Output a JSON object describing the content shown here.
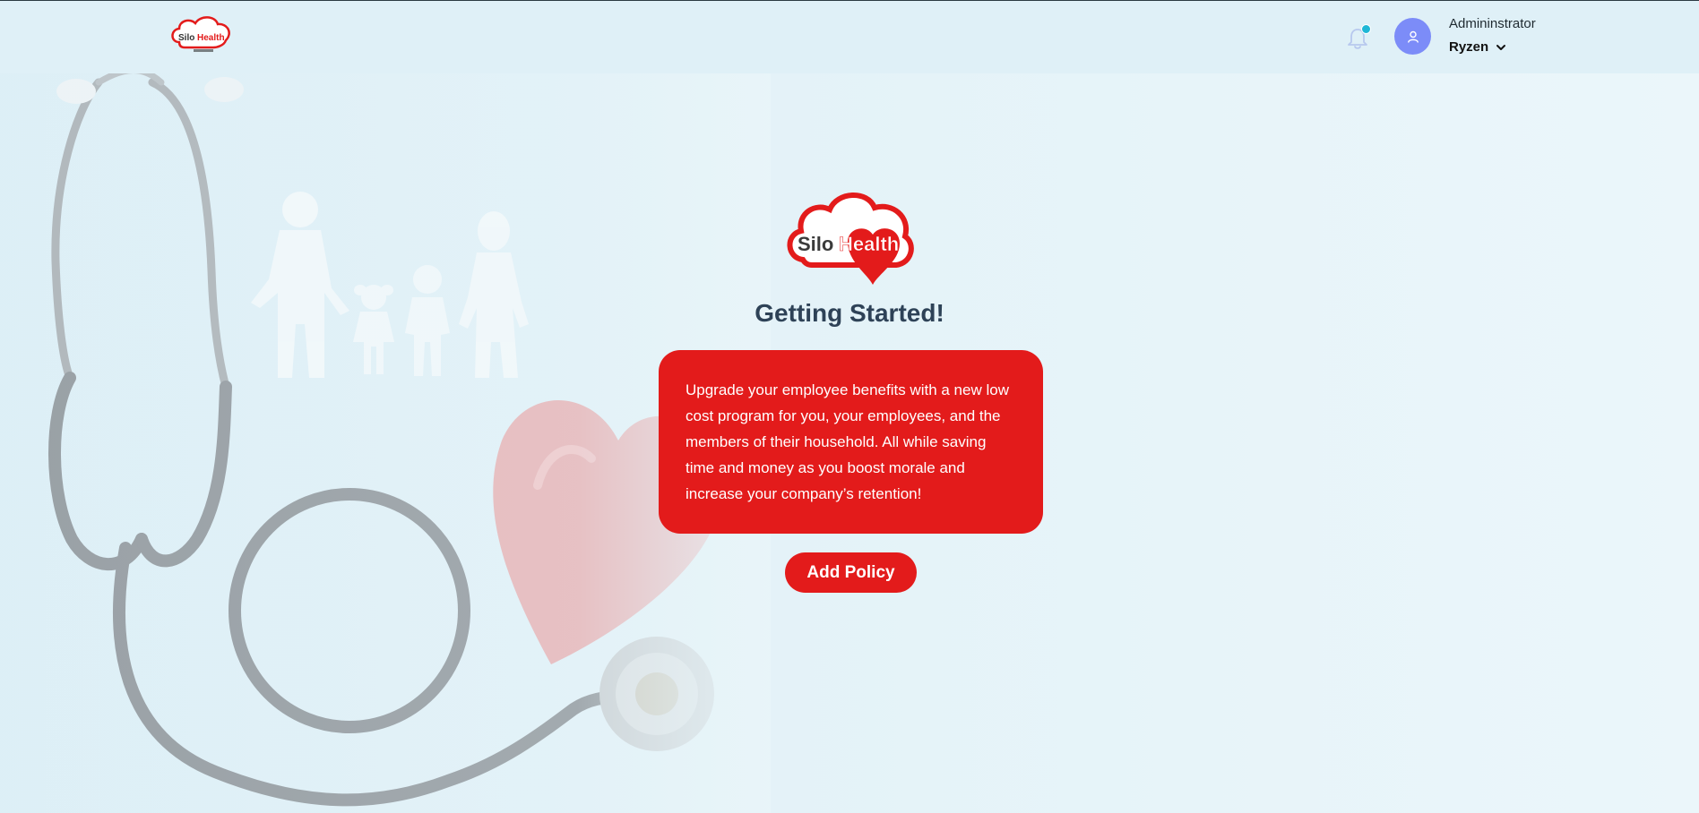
{
  "header": {
    "brand_logo": {
      "name": "silohealth-logo",
      "text_silo": "Silo",
      "text_health": "Health"
    },
    "notifications": {
      "icon": "bell-icon",
      "has_unread": true,
      "dot_color": "#1fb7d6"
    },
    "user": {
      "avatar_icon": "user-icon",
      "avatar_color": "#7c8cf8",
      "role": "Admininstrator",
      "name": "Ryzen",
      "menu_icon": "chevron-down-icon"
    }
  },
  "main": {
    "logo": {
      "text_silo": "Silo",
      "text_health": "Health"
    },
    "title": "Getting Started!",
    "description": "Upgrade your employee benefits with a new low cost program for you, your employees, and the members of their household. All while saving time and money as you boost morale and increase your company’s retention!",
    "primary_action_label": "Add Policy"
  },
  "theme": {
    "accent": "#e31b1b",
    "title_color": "#2e4257",
    "header_bg": "#dff0f7"
  },
  "background_image": {
    "subject": "stethoscope-heart-family-illustration"
  }
}
